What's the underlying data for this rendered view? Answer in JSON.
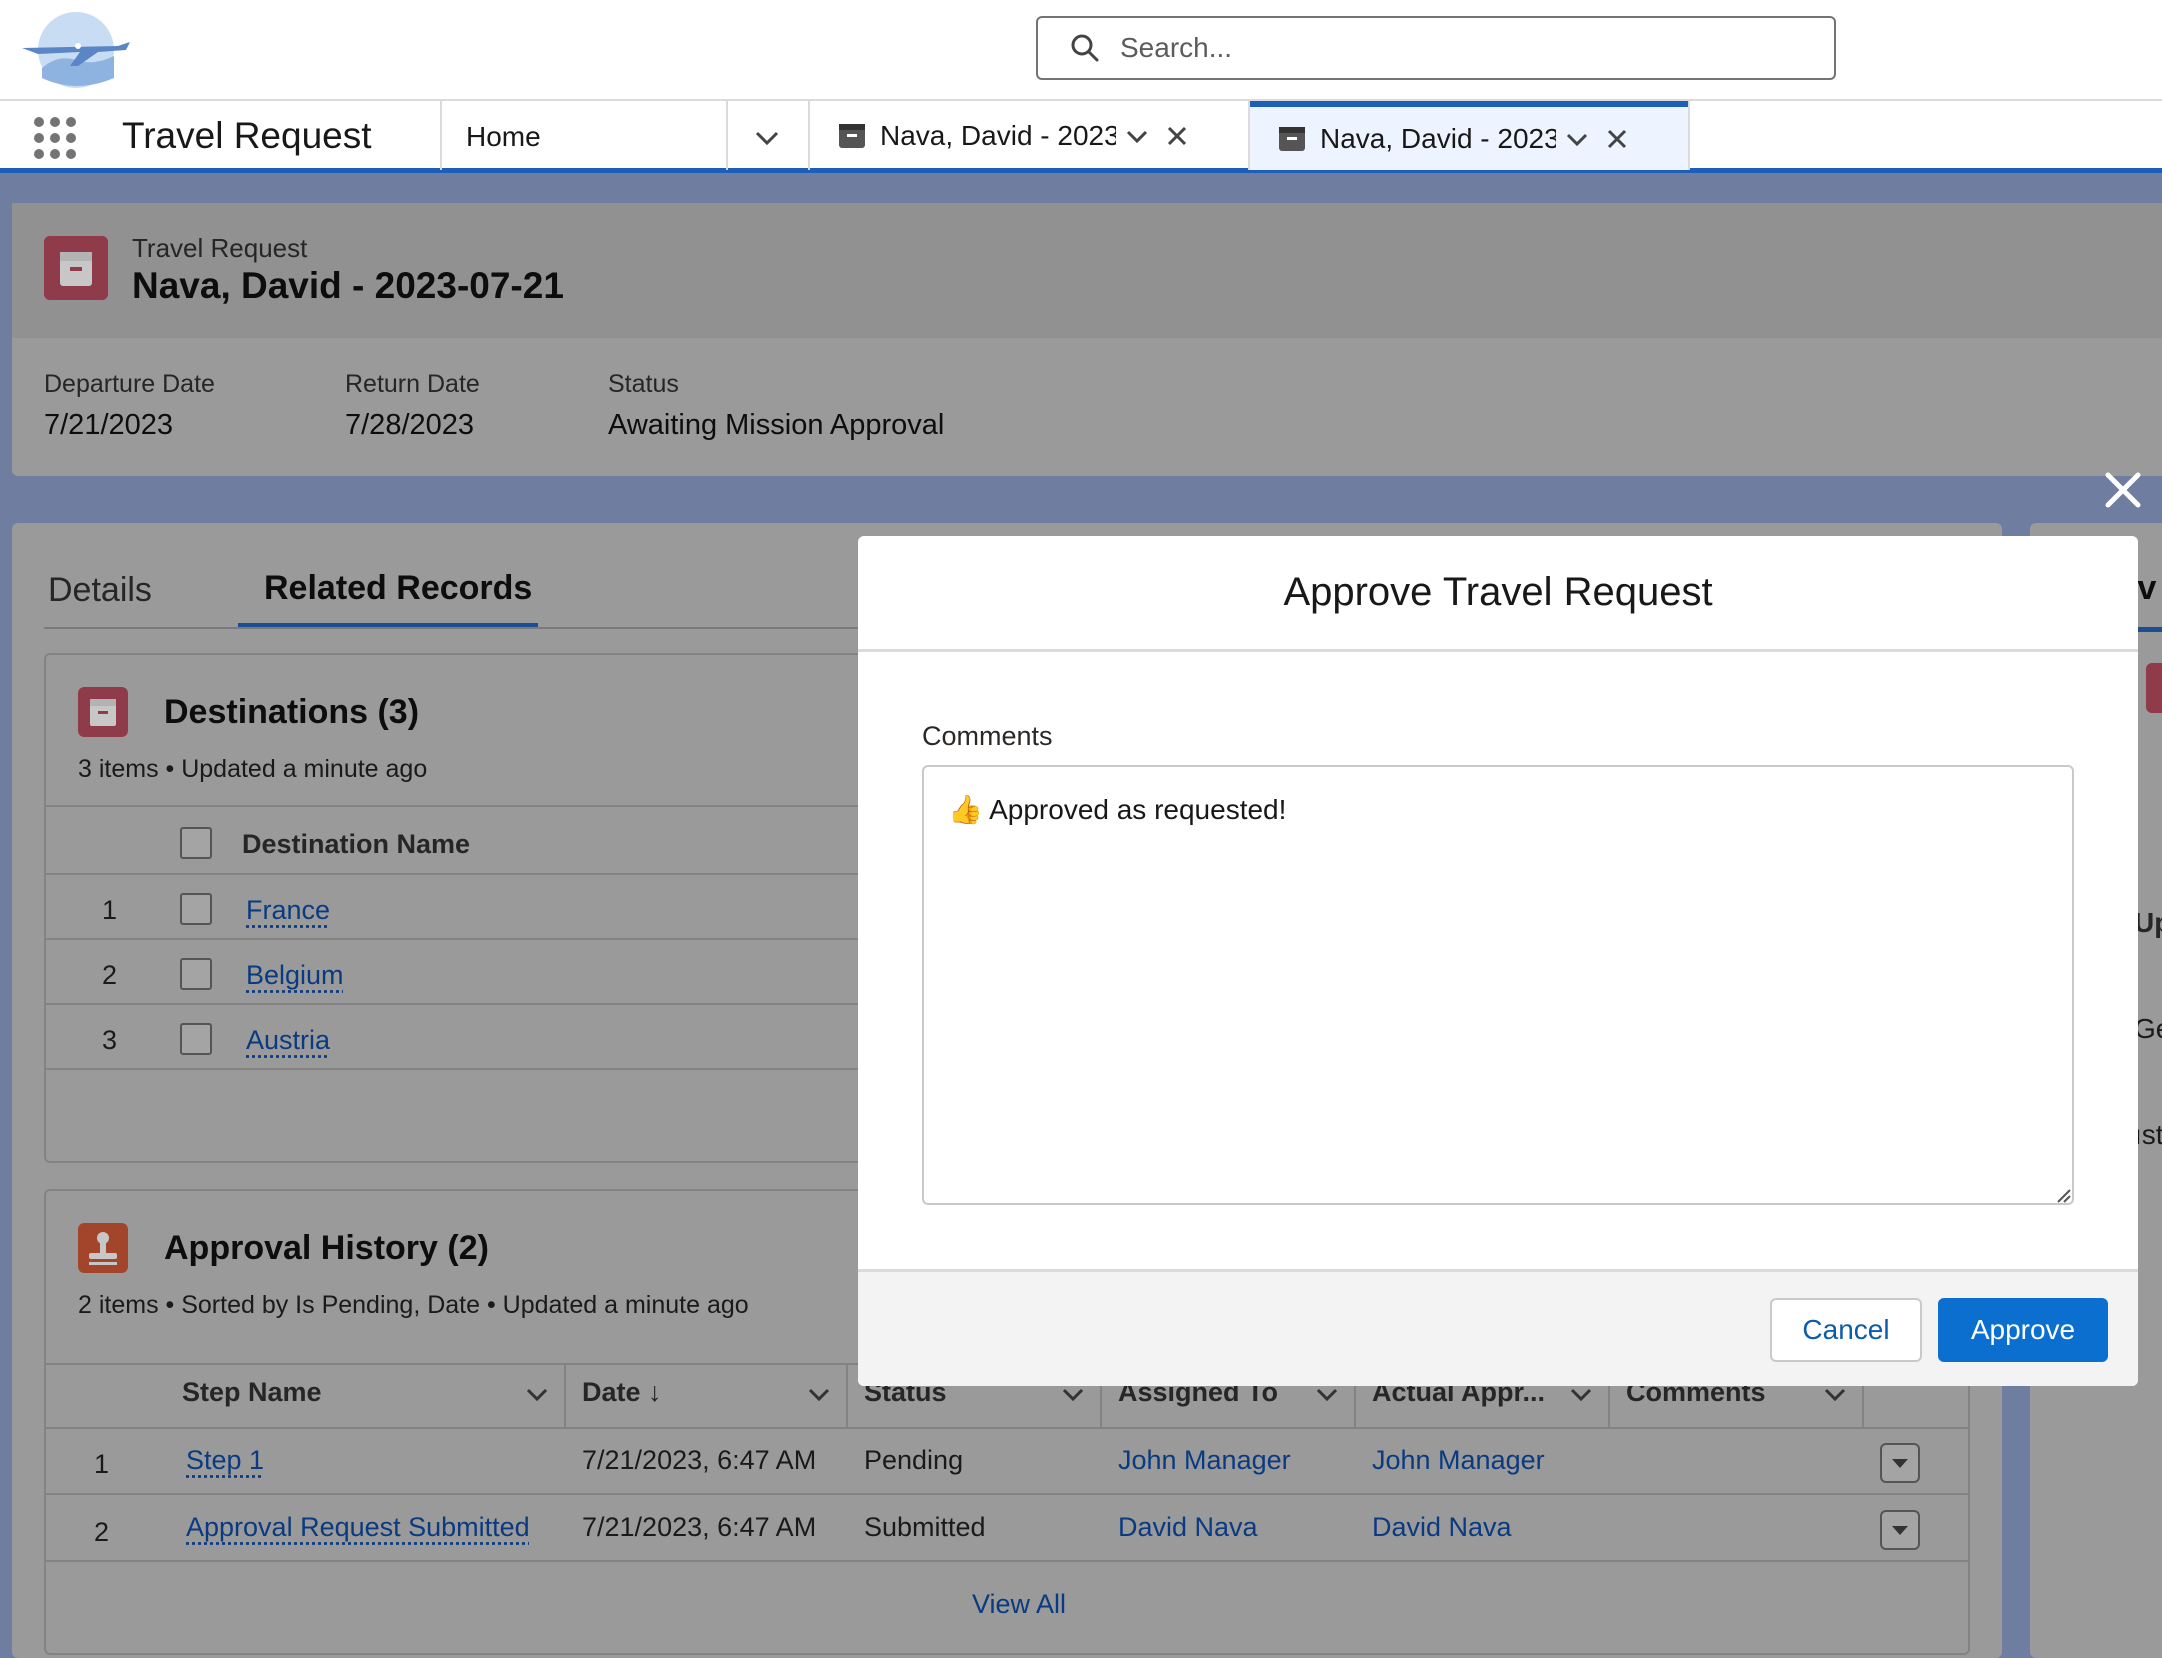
{
  "global_header": {
    "search_placeholder": "Search..."
  },
  "nav": {
    "app_name": "Travel Request",
    "home_label": "Home",
    "tabs": [
      {
        "label": "Nava, David - 2023...",
        "active": false
      },
      {
        "label": "Nava, David - 2023...",
        "active": true
      }
    ]
  },
  "record": {
    "object_type": "Travel Request",
    "title": "Nava, David - 2023-07-21",
    "fields": [
      {
        "label": "Departure Date",
        "value": "7/21/2023"
      },
      {
        "label": "Return Date",
        "value": "7/28/2023"
      },
      {
        "label": "Status",
        "value": "Awaiting Mission Approval"
      }
    ]
  },
  "record_tabs": {
    "details": "Details",
    "related": "Related Records"
  },
  "destinations": {
    "title": "Destinations (3)",
    "meta": "3 items • Updated a minute ago",
    "column": "Destination Name",
    "rows": [
      {
        "num": "1",
        "name": "France"
      },
      {
        "num": "2",
        "name": "Belgium"
      },
      {
        "num": "3",
        "name": "Austria"
      }
    ]
  },
  "approval_history": {
    "title": "Approval History (2)",
    "meta": "2 items • Sorted by Is Pending, Date • Updated a minute ago",
    "columns": [
      "Step Name",
      "Date ↓",
      "Status",
      "Assigned To",
      "Actual Appr...",
      "Comments"
    ],
    "rows": [
      {
        "num": "1",
        "step": "Step 1",
        "date": "7/21/2023, 6:47 AM",
        "status": "Pending",
        "assigned": "John Manager",
        "actual": "John Manager"
      },
      {
        "num": "2",
        "step": "Approval Request Submitted",
        "date": "7/21/2023, 6:47 AM",
        "status": "Submitted",
        "assigned": "David Nava",
        "actual": "David Nava"
      }
    ],
    "view_all": "View All"
  },
  "side_panel_fragments": [
    "iv",
    "Up",
    "Ge",
    "ıst"
  ],
  "modal": {
    "title": "Approve Travel Request",
    "comments_label": "Comments",
    "comments_value": "👍 Approved as requested!",
    "cancel_label": "Cancel",
    "approve_label": "Approve"
  },
  "colors": {
    "brand_blue": "#0b6fd0",
    "nav_accent": "#1b5fb8",
    "travel_icon": "#c23934",
    "approval_icon": "#e4582f"
  }
}
